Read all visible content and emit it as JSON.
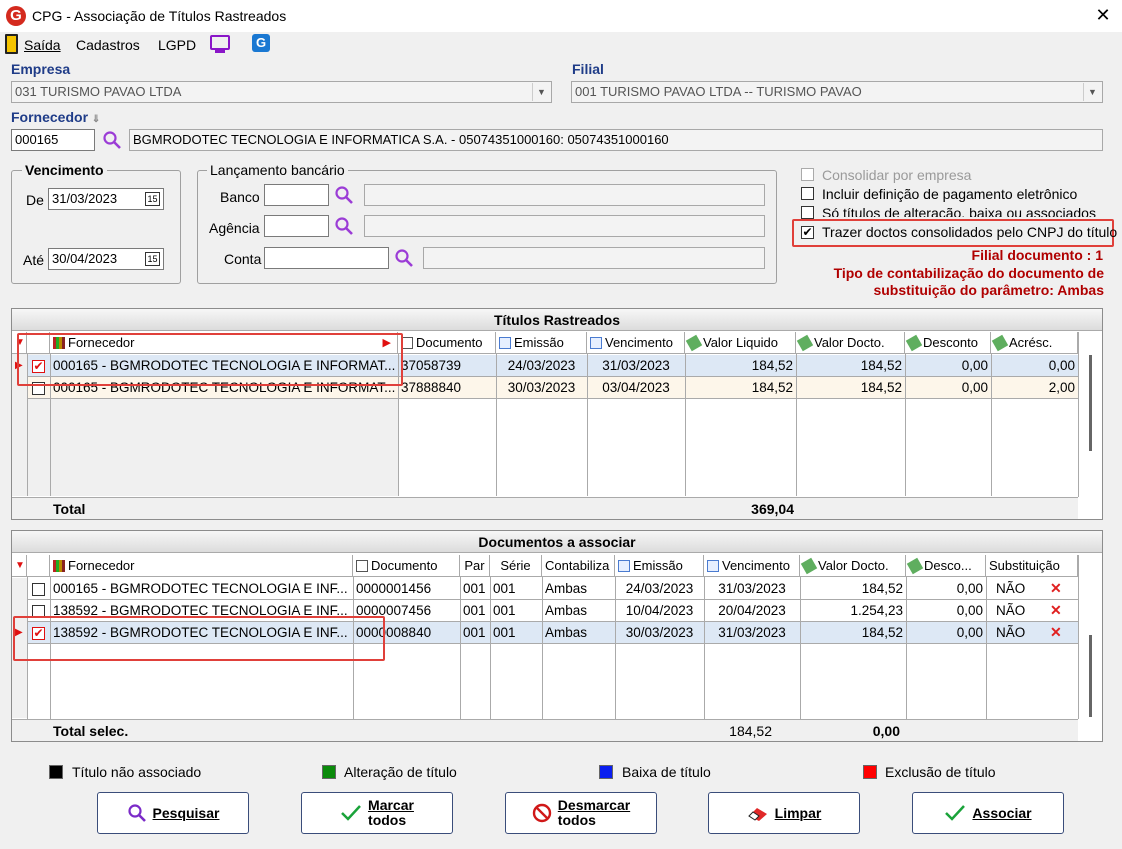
{
  "window": {
    "title": "CPG - Associação de Títulos Rastreados",
    "close": "✕"
  },
  "menu": {
    "saida": "Saída",
    "cadastros": "Cadastros",
    "lgpd": "LGPD"
  },
  "empresa": {
    "label": "Empresa",
    "value": "031 TURISMO PAVAO LTDA"
  },
  "filial": {
    "label": "Filial",
    "value": "001 TURISMO PAVAO LTDA -- TURISMO PAVAO"
  },
  "fornecedor": {
    "label": "Fornecedor",
    "code": "000165",
    "name": "BGMRODOTEC TECNOLOGIA E INFORMATICA S.A. - 05074351000160: 05074351000160"
  },
  "vencimento": {
    "title": "Vencimento",
    "de_label": "De",
    "de": "31/03/2023",
    "ate_label": "Até",
    "ate": "30/04/2023",
    "cal": "15"
  },
  "lancamento": {
    "title": "Lançamento bancário",
    "banco": "Banco",
    "agencia": "Agência",
    "conta": "Conta"
  },
  "options": {
    "consolidar": "Consolidar por empresa",
    "incluir": "Incluir definição de pagamento eletrônico",
    "so_titulos": "Só títulos de alteração, baixa ou associados",
    "trazer": "Trazer doctos consolidados pelo CNPJ do título",
    "check": "✔"
  },
  "info": {
    "filial_doc": "Filial documento : 1",
    "tipo1": "Tipo de contabilização do documento de",
    "tipo2": "substituição do parâmetro: Ambas"
  },
  "titulos": {
    "title": "Títulos Rastreados",
    "headers": {
      "fornecedor": "Fornecedor",
      "documento": "Documento",
      "emissao": "Emissão",
      "vencimento": "Vencimento",
      "valor_liquido": "Valor Liquido",
      "valor_docto": "Valor Docto.",
      "desconto": "Desconto",
      "acresc": "Acrésc."
    },
    "rows": [
      {
        "checked": "✔",
        "fornecedor": "000165 - BGMRODOTEC TECNOLOGIA E INFORMAT...",
        "documento": "37058739",
        "emissao": "24/03/2023",
        "vencimento": "31/03/2023",
        "valor_liquido": "184,52",
        "valor_docto": "184,52",
        "desconto": "0,00",
        "acresc": "0,00"
      },
      {
        "checked": "",
        "fornecedor": "000165 - BGMRODOTEC TECNOLOGIA E INFORMAT...",
        "documento": "37888840",
        "emissao": "30/03/2023",
        "vencimento": "03/04/2023",
        "valor_liquido": "184,52",
        "valor_docto": "184,52",
        "desconto": "0,00",
        "acresc": "2,00"
      }
    ],
    "total_label": "Total",
    "total_value": "369,04"
  },
  "documentos": {
    "title": "Documentos a associar",
    "headers": {
      "fornecedor": "Fornecedor",
      "documento": "Documento",
      "par": "Par",
      "serie": "Série",
      "contabiliza": "Contabiliza",
      "emissao": "Emissão",
      "vencimento": "Vencimento",
      "valor_docto": "Valor Docto.",
      "desconto": "Desco...",
      "substituicao": "Substituição"
    },
    "rows": [
      {
        "checked": "",
        "fornecedor": "000165 - BGMRODOTEC TECNOLOGIA E INF...",
        "documento": "0000001456",
        "par": "001",
        "serie": "001",
        "contabiliza": "Ambas",
        "emissao": "24/03/2023",
        "vencimento": "31/03/2023",
        "valor_docto": "184,52",
        "desconto": "0,00",
        "substituicao": "NÃO",
        "x": "✕"
      },
      {
        "checked": "",
        "fornecedor": "138592 - BGMRODOTEC TECNOLOGIA E INF...",
        "documento": "0000007456",
        "par": "001",
        "serie": "001",
        "contabiliza": "Ambas",
        "emissao": "10/04/2023",
        "vencimento": "20/04/2023",
        "valor_docto": "1.254,23",
        "desconto": "0,00",
        "substituicao": "NÃO",
        "x": "✕"
      },
      {
        "checked": "✔",
        "fornecedor": "138592 - BGMRODOTEC TECNOLOGIA E INF...",
        "documento": "0000008840",
        "par": "001",
        "serie": "001",
        "contabiliza": "Ambas",
        "emissao": "30/03/2023",
        "vencimento": "31/03/2023",
        "valor_docto": "184,52",
        "desconto": "0,00",
        "substituicao": "NÃO",
        "x": "✕"
      }
    ],
    "total_label": "Total selec.",
    "total_docto": "184,52",
    "total_desc": "0,00"
  },
  "legend": {
    "nao_associado": "Título não associado",
    "alteracao": "Alteração de título",
    "baixa": "Baixa de título",
    "exclusao": "Exclusão de título"
  },
  "colors": {
    "nao_associado": "#000000",
    "alteracao": "#0a8a0a",
    "baixa": "#0a1ef0",
    "exclusao": "#ff0000",
    "accent": "#1f3c88",
    "info_red": "#b00000"
  },
  "buttons": {
    "pesquisar": "Pesquisar",
    "marcar1": "Marcar",
    "marcar2": "todos",
    "desmarcar1": "Desmarcar",
    "desmarcar2": "todos",
    "limpar": "Limpar",
    "associar": "Associar"
  }
}
